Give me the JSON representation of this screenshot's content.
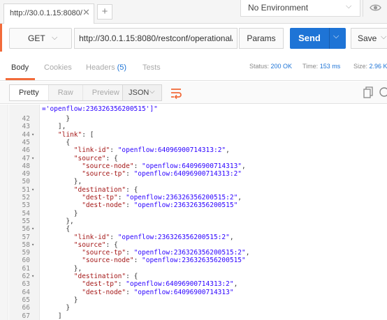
{
  "tab": {
    "title": "http://30.0.1.15:8080/",
    "close": "✕",
    "new": "+"
  },
  "environment": {
    "label": "No Environment",
    "chevron": "⌵"
  },
  "request": {
    "method": "GET",
    "url": "http://30.0.1.15:8080/restconf/operational/net...",
    "params_label": "Params",
    "send_label": "Send",
    "save_label": "Save"
  },
  "response_tabs": {
    "body": "Body",
    "cookies": "Cookies",
    "headers": "Headers",
    "headers_count": "(5)",
    "tests": "Tests"
  },
  "status": {
    "status_label": "Status:",
    "status_value": "200 OK",
    "time_label": "Time:",
    "time_value": "153 ms",
    "size_label": "Size:",
    "size_value": "2.96 K"
  },
  "view_modes": [
    "Pretty",
    "Raw",
    "Preview"
  ],
  "format": "JSON",
  "icons": {
    "eye": "eye-icon",
    "wrap": "wrap-lines-icon",
    "copy": "copy-icon",
    "search": "search-icon"
  },
  "colors": {
    "accent_orange": "#f26b3a",
    "send_blue": "#1e74d6",
    "json_key": "#a31515",
    "json_string": "#2a00ff"
  },
  "code_top_fragment": "='openflow:236326356200515']\"",
  "code_lines": [
    {
      "n": "42",
      "fold": false,
      "text": "      }"
    },
    {
      "n": "43",
      "fold": false,
      "text": "    ],"
    },
    {
      "n": "44",
      "fold": true,
      "text": "    \"link\": ["
    },
    {
      "n": "45",
      "fold": false,
      "text": "      {"
    },
    {
      "n": "46",
      "fold": false,
      "text": "        \"link-id\": \"openflow:64096900714313:2\","
    },
    {
      "n": "47",
      "fold": true,
      "text": "        \"source\": {"
    },
    {
      "n": "48",
      "fold": false,
      "text": "          \"source-node\": \"openflow:64096900714313\","
    },
    {
      "n": "49",
      "fold": false,
      "text": "          \"source-tp\": \"openflow:64096900714313:2\""
    },
    {
      "n": "50",
      "fold": false,
      "text": "        },"
    },
    {
      "n": "51",
      "fold": true,
      "text": "        \"destination\": {"
    },
    {
      "n": "52",
      "fold": false,
      "text": "          \"dest-tp\": \"openflow:236326356200515:2\","
    },
    {
      "n": "53",
      "fold": false,
      "text": "          \"dest-node\": \"openflow:236326356200515\""
    },
    {
      "n": "54",
      "fold": false,
      "text": "        }"
    },
    {
      "n": "55",
      "fold": false,
      "text": "      },"
    },
    {
      "n": "56",
      "fold": true,
      "text": "      {"
    },
    {
      "n": "57",
      "fold": false,
      "text": "        \"link-id\": \"openflow:236326356200515:2\","
    },
    {
      "n": "58",
      "fold": true,
      "text": "        \"source\": {"
    },
    {
      "n": "59",
      "fold": false,
      "text": "          \"source-tp\": \"openflow:236326356200515:2\","
    },
    {
      "n": "60",
      "fold": false,
      "text": "          \"source-node\": \"openflow:236326356200515\""
    },
    {
      "n": "61",
      "fold": false,
      "text": "        },"
    },
    {
      "n": "62",
      "fold": true,
      "text": "        \"destination\": {"
    },
    {
      "n": "63",
      "fold": false,
      "text": "          \"dest-tp\": \"openflow:64096900714313:2\","
    },
    {
      "n": "64",
      "fold": false,
      "text": "          \"dest-node\": \"openflow:64096900714313\""
    },
    {
      "n": "65",
      "fold": false,
      "text": "        }"
    },
    {
      "n": "66",
      "fold": false,
      "text": "      }"
    },
    {
      "n": "67",
      "fold": false,
      "text": "    ]"
    }
  ]
}
